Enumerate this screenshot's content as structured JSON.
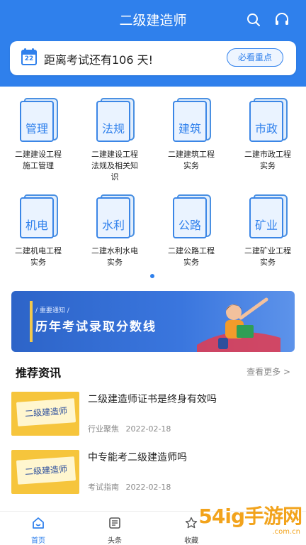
{
  "header": {
    "title": "二级建造师",
    "icons": [
      "search-icon",
      "headset-icon"
    ],
    "accent_color": "#2f80ec"
  },
  "countdown": {
    "calendar_day": "22",
    "text": "距离考试还有106 天!",
    "button_label": "必看重点"
  },
  "categories": [
    {
      "label": "管理",
      "name": "二建建设工程\n施工管理"
    },
    {
      "label": "法规",
      "name": "二建建设工程\n法规及相关知\n识"
    },
    {
      "label": "建筑",
      "name": "二建建筑工程\n实务"
    },
    {
      "label": "市政",
      "name": "二建市政工程\n实务"
    },
    {
      "label": "机电",
      "name": "二建机电工程\n实务"
    },
    {
      "label": "水利",
      "name": "二建水利水电\n实务"
    },
    {
      "label": "公路",
      "name": "二建公路工程\n实务"
    },
    {
      "label": "矿业",
      "name": "二建矿业工程\n实务"
    }
  ],
  "banner": {
    "tag": "/ 重要通知 /",
    "title": "历年考试录取分数线"
  },
  "recommend": {
    "title": "推荐资讯",
    "more_label": "查看更多 >"
  },
  "news": [
    {
      "thumb_text": "二级建造师",
      "title": "二级建造师证书是终身有效吗",
      "source": "行业聚焦",
      "date": "2022-02-18"
    },
    {
      "thumb_text": "二级建造师",
      "title": "中专能考二级建造师吗",
      "source": "考试指南",
      "date": "2022-02-18"
    }
  ],
  "tabbar": {
    "items": [
      {
        "label": "首页",
        "icon": "home-icon",
        "active": true
      },
      {
        "label": "头条",
        "icon": "news-icon",
        "active": false
      },
      {
        "label": "收藏",
        "icon": "star-icon",
        "active": false
      }
    ]
  },
  "watermark": {
    "text": "54ig手游网",
    "sub": ".com.cn"
  }
}
